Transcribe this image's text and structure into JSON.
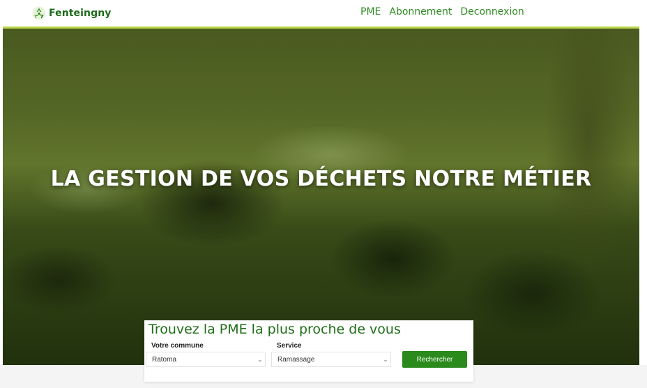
{
  "navbar": {
    "brand_name": "Fenteingny",
    "links": [
      {
        "label": "PME"
      },
      {
        "label": "Abonnement"
      },
      {
        "label": "Deconnexion"
      }
    ]
  },
  "hero": {
    "title": "LA GESTION DE VOS DÉCHETS NOTRE MÉTIER"
  },
  "search": {
    "title": "Trouvez la PME la plus proche de vous",
    "commune_label": "Votre commune",
    "commune_value": "Ratoma",
    "service_label": "Service",
    "service_value": "Ramassage",
    "button_label": "Rechercher"
  },
  "colors": {
    "brand": "#1d6a1a",
    "nav_link": "#2f8a22",
    "accent_line": "#b9d64a",
    "button": "#2a8a1c"
  },
  "icons": {
    "brand_logo": "recycle-icon",
    "select_arrow": "chevron-down-icon"
  }
}
